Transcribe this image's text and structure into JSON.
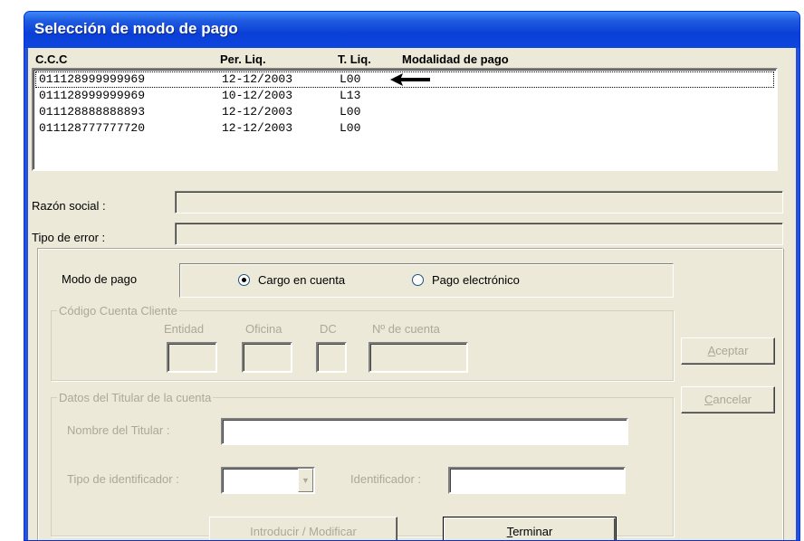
{
  "window": {
    "title": "Selección de modo de pago"
  },
  "list": {
    "columns": [
      "C.C.C",
      "Per. Liq.",
      "T. Liq.",
      "Modalidad de pago"
    ],
    "rows": [
      {
        "ccc": "011128999999969",
        "per": "12-12/2003",
        "tliq": "L00",
        "modalidad": ""
      },
      {
        "ccc": "011128999999969",
        "per": "10-12/2003",
        "tliq": "L13",
        "modalidad": ""
      },
      {
        "ccc": "011128888888893",
        "per": "12-12/2003",
        "tliq": "L00",
        "modalidad": ""
      },
      {
        "ccc": "011128777777720",
        "per": "12-12/2003",
        "tliq": "L00",
        "modalidad": ""
      }
    ],
    "selected_index": 0,
    "pointer_icon": "left-arrow-icon"
  },
  "razon_social": {
    "label": "Razón social :",
    "value": ""
  },
  "tipo_error": {
    "label": "Tipo de error :",
    "value": ""
  },
  "modo_pago": {
    "label": "Modo de pago",
    "options": [
      "Cargo en cuenta",
      "Pago electrónico"
    ],
    "selected": "Cargo en cuenta"
  },
  "ccc_group": {
    "title": "Código Cuenta Cliente",
    "entidad_label": "Entidad",
    "oficina_label": "Oficina",
    "dc_label": "DC",
    "cuenta_label": "Nº de cuenta",
    "entidad": "",
    "oficina": "",
    "dc": "",
    "cuenta": ""
  },
  "titular_group": {
    "title": "Datos del Titular de la cuenta",
    "nombre_label": "Nombre del Titular :",
    "nombre": "",
    "tipo_id_label": "Tipo de identificador :",
    "tipo_id": "",
    "identificador_label": "Identificador :",
    "identificador": ""
  },
  "buttons": {
    "aceptar": {
      "first": "A",
      "rest": "ceptar"
    },
    "cancelar": {
      "first": "C",
      "rest": "ancelar"
    },
    "introducir": "Introducir / Modificar",
    "terminar": {
      "first": "T",
      "rest": "erminar"
    }
  },
  "colors": {
    "titlebar": "#0a3fd6",
    "face": "#ece9d8",
    "disabled_text": "#aca899"
  }
}
